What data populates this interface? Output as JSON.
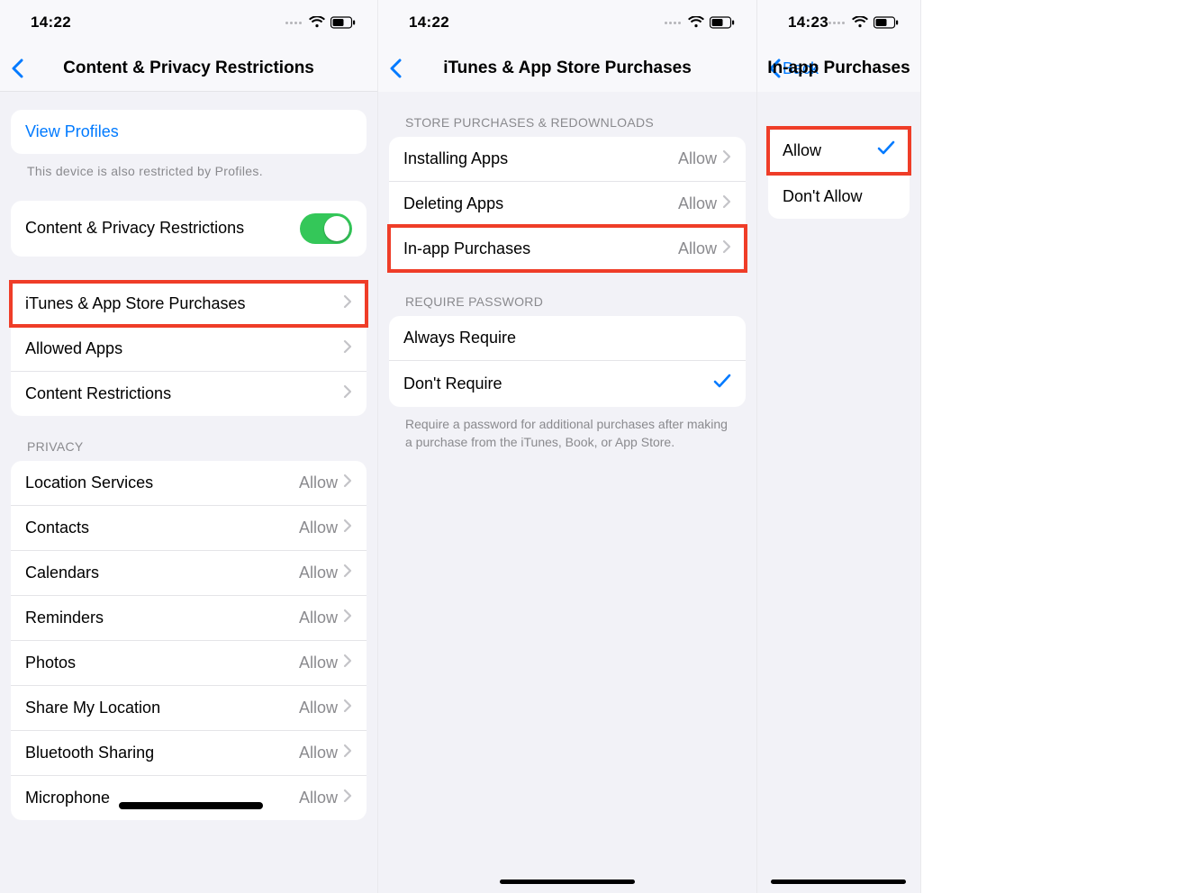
{
  "phone1": {
    "time": "14:22",
    "title": "Content & Privacy Restrictions",
    "view_profiles": "View Profiles",
    "profiles_note": "This device is also restricted by Profiles.",
    "toggle_label": "Content & Privacy Restrictions",
    "items": [
      {
        "label": "iTunes & App Store Purchases",
        "highlight": true
      },
      {
        "label": "Allowed Apps"
      },
      {
        "label": "Content Restrictions"
      }
    ],
    "privacy_header": "PRIVACY",
    "privacy_items": [
      {
        "label": "Location Services",
        "value": "Allow"
      },
      {
        "label": "Contacts",
        "value": "Allow"
      },
      {
        "label": "Calendars",
        "value": "Allow"
      },
      {
        "label": "Reminders",
        "value": "Allow"
      },
      {
        "label": "Photos",
        "value": "Allow"
      },
      {
        "label": "Share My Location",
        "value": "Allow"
      },
      {
        "label": "Bluetooth Sharing",
        "value": "Allow"
      },
      {
        "label": "Microphone",
        "value": "Allow"
      }
    ]
  },
  "phone2": {
    "time": "14:22",
    "title": "iTunes & App Store Purchases",
    "store_header": "STORE PURCHASES & REDOWNLOADS",
    "store_items": [
      {
        "label": "Installing Apps",
        "value": "Allow"
      },
      {
        "label": "Deleting Apps",
        "value": "Allow"
      },
      {
        "label": "In-app Purchases",
        "value": "Allow",
        "highlight": true
      }
    ],
    "require_header": "REQUIRE PASSWORD",
    "require_items": [
      {
        "label": "Always Require"
      },
      {
        "label": "Don't Require",
        "checked": true
      }
    ],
    "require_footer": "Require a password for additional purchases after making a purchase from the iTunes, Book, or App Store."
  },
  "phone3": {
    "time": "14:23",
    "back_label": "Back",
    "title": "In-app Purchases",
    "items": [
      {
        "label": "Allow",
        "checked": true,
        "highlight": true
      },
      {
        "label": "Don't Allow"
      }
    ]
  }
}
